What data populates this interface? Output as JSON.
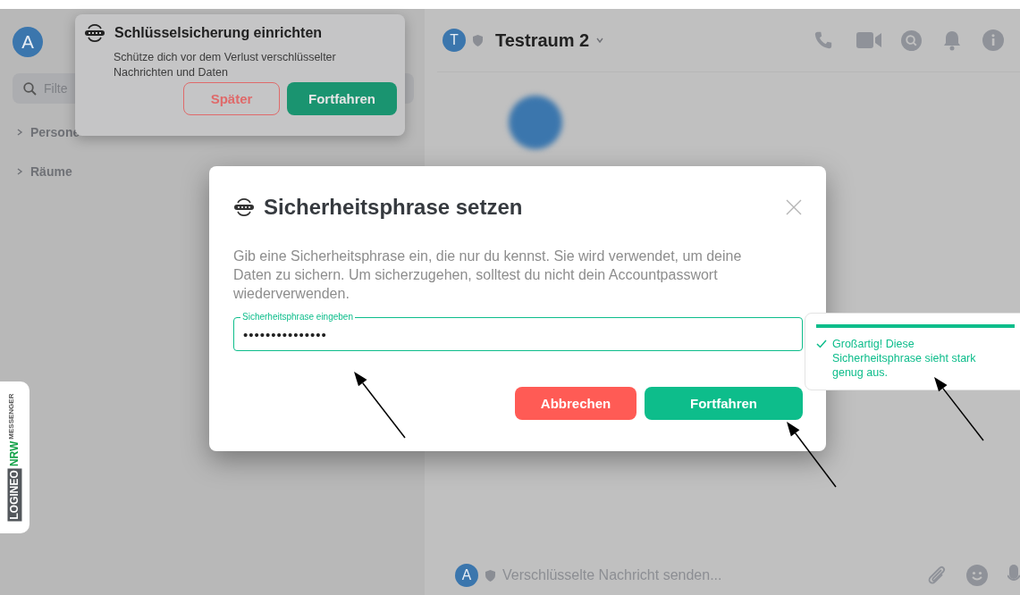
{
  "sidebar": {
    "user_avatar": "A",
    "filter": {
      "placeholder": "Filte"
    },
    "sections": [
      {
        "label": "Persone",
        "expanded": false
      },
      {
        "label": "Räume",
        "expanded": false
      }
    ]
  },
  "room_header": {
    "avatar": "T",
    "title": "Testraum 2"
  },
  "composer": {
    "avatar": "A",
    "placeholder": "Verschlüsselte Nachricht senden..."
  },
  "toast": {
    "title": "Schlüsselsicherung einrichten",
    "message": "Schütze dich vor dem Verlust verschlüsselter Nachrichten und Daten",
    "buttons": [
      {
        "label": "Später",
        "kind": "secondary"
      },
      {
        "label": "Fortfahren",
        "kind": "primary"
      }
    ]
  },
  "dialog": {
    "title": "Sicherheitsphrase setzen",
    "description": "Gib eine Sicherheitsphrase ein, die nur du kennst. Sie wird verwendet, um deine Daten zu sichern. Um sicherzugehen, solltest du nicht dein Accountpasswort wiederverwenden.",
    "field": {
      "label": "Sicherheitsphrase eingeben",
      "value": "•••••••••••••••"
    },
    "buttons": [
      {
        "label": "Abbrechen",
        "kind": "danger"
      },
      {
        "label": "Fortfahren",
        "kind": "primary"
      }
    ]
  },
  "strength_tooltip": {
    "level": 1,
    "message": "Großartig! Diese Sicherheitsphrase sieht stark genug aus."
  },
  "logo": {
    "name_part": "LOGINEO",
    "region_part": "NRW",
    "product": "MESSENGER"
  }
}
